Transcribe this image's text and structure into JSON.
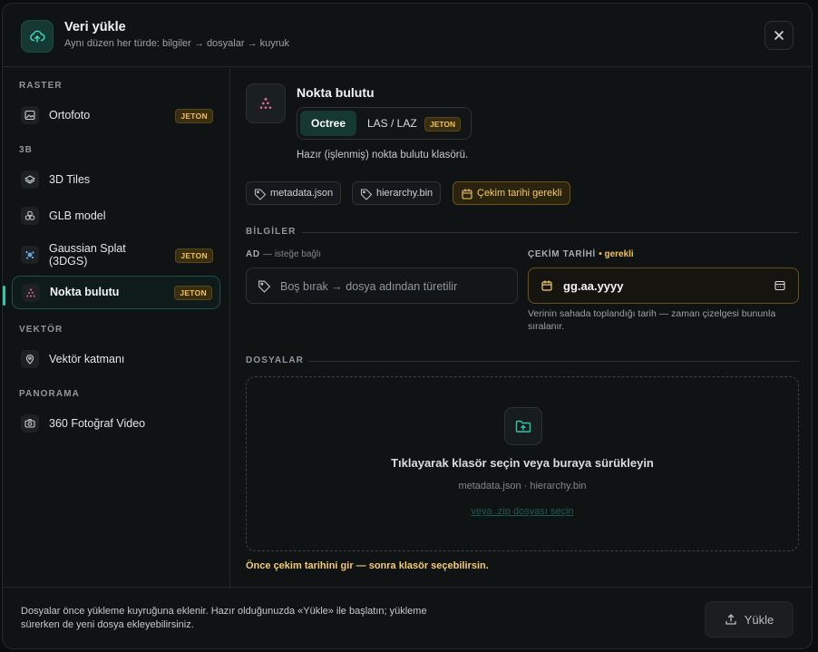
{
  "header": {
    "title": "Veri yükle",
    "subtitle": "Aynı düzen her türde: bilgiler → dosyalar → kuyruk",
    "icon": "cloud-upload-icon",
    "close_icon": "close-icon"
  },
  "sidebar": {
    "sections": [
      {
        "label": "RASTER"
      },
      {
        "label": "3B"
      },
      {
        "label": "VEKTÖR"
      },
      {
        "label": "PANORAMA"
      }
    ],
    "items": [
      {
        "label": "Ortofoto",
        "badge": "JETON",
        "icon": "image-icon"
      },
      {
        "label": "3D Tiles",
        "icon": "layers-icon"
      },
      {
        "label": "GLB model",
        "icon": "cubes-icon"
      },
      {
        "label": "Gaussian Splat",
        "label2": "(3DGS)",
        "badge": "JETON",
        "icon": "splat-icon"
      },
      {
        "label": "Nokta bulutu",
        "badge": "JETON",
        "icon": "point-cloud-icon",
        "active": true
      },
      {
        "label": "Vektör katmanı",
        "icon": "map-pin-icon"
      },
      {
        "label": "360 Fotoğraf Video",
        "icon": "camera-icon"
      }
    ]
  },
  "main": {
    "title": "Nokta bulutu",
    "segments": {
      "opt1": "Octree",
      "opt2": "LAS / LAZ",
      "badge": "JETON",
      "selected": "Octree"
    },
    "description": "Hazır (işlenmiş) nokta bulutu klasörü.",
    "chips": [
      "metadata.json",
      "hierarchy.bin",
      "Çekim tarihi gerekli"
    ],
    "info_section": "BİLGİLER",
    "name_field": {
      "label": "AD",
      "hint": "— isteğe bağlı",
      "placeholder": "Boş bırak → dosya adından türetilir"
    },
    "date_field": {
      "label": "ÇEKİM TARİHİ",
      "required": "gerekli",
      "value": "gg.aa.yyyy",
      "help": "Verinin sahada toplandığı tarih — zaman çizelgesi bununla sıralanır."
    },
    "files_section": "DOSYALAR",
    "dropzone": {
      "title": "Tıklayarak klasör seçin veya buraya sürükleyin",
      "files": "metadata.json · hierarchy.bin",
      "zip_link": "veya .zip dosyası seçin"
    },
    "warning": "Önce çekim tarihini gir — sonra klasör seçebilirsin."
  },
  "footer": {
    "text": "Dosyalar önce yükleme kuyruğuna eklenir. Hazır olduğunuzda «Yükle» ile başlatın; yükleme sürerken de yeni dosya ekleyebilirsiniz.",
    "upload_label": "Yükle"
  },
  "colors": {
    "accent": "#2ec7a8",
    "warning": "#f2c15a",
    "background": "#101314"
  }
}
